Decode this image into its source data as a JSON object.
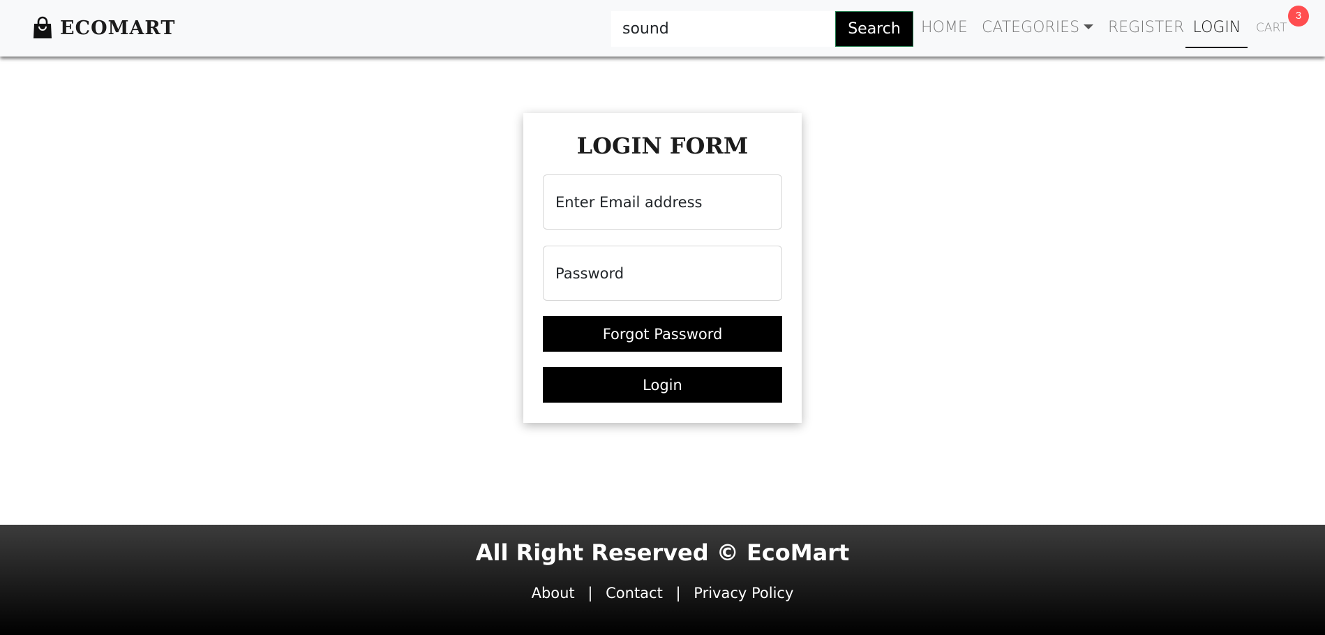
{
  "header": {
    "brand": "ECOMART",
    "brand_icon": "shopping-bag-icon",
    "search": {
      "value": "sound",
      "button_label": "Search"
    },
    "nav": {
      "home": "HOME",
      "categories": "CATEGORIES",
      "register": "REGISTER",
      "login": "LOGIN",
      "cart": "CART",
      "cart_count": "3"
    }
  },
  "login_form": {
    "title": "LOGIN FORM",
    "email_placeholder": "Enter Email address",
    "password_placeholder": "Password",
    "forgot_button": "Forgot Password",
    "login_button": "Login"
  },
  "footer": {
    "copyright": "All Right Reserved © EcoMart",
    "links": [
      "About",
      "Contact",
      "Privacy Policy"
    ],
    "separator": "|"
  },
  "colors": {
    "navbar_bg": "#f8f9fa",
    "button_bg": "#000000",
    "badge": "#ff4d4f",
    "footer_gradient_top": "#3c3c3c",
    "footer_gradient_bottom": "#000000"
  }
}
